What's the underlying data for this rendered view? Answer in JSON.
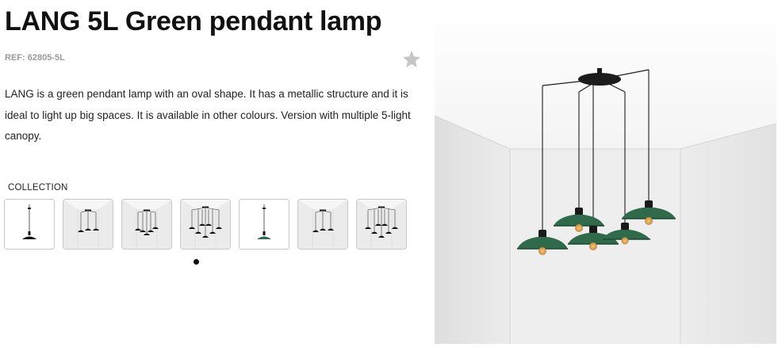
{
  "product": {
    "title": "LANG 5L Green pendant lamp",
    "ref": "REF: 62805-5L",
    "description": "LANG is a green pendant lamp with an oval shape. It has a metallic structure and it is ideal to light up big spaces. It is available in other colours. Version with multiple 5-light canopy.",
    "favorite_icon": "star-icon",
    "lamp_color": "#2f6b4a"
  },
  "collection": {
    "label": "COLLECTION",
    "thumbnails": [
      {
        "variant": "single pendant, black"
      },
      {
        "variant": "3 pendants, black"
      },
      {
        "variant": "5 pendants, black"
      },
      {
        "variant": "7 pendants, black"
      },
      {
        "variant": "single pendant, green"
      },
      {
        "variant": "3 pendants, black"
      },
      {
        "variant": "7 pendants, black"
      }
    ],
    "pagination": {
      "current": 1,
      "total": 1
    }
  }
}
